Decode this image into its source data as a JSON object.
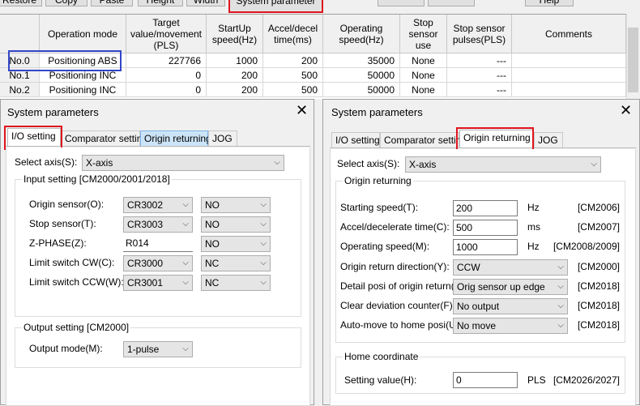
{
  "toolbar": {
    "buttons": [
      "Restore",
      "Copy",
      "Paste",
      "Height",
      "Width",
      "System parameter",
      "",
      "",
      "Help"
    ]
  },
  "grid": {
    "headers": [
      "Operation mode",
      "Target value/movement (PLS)",
      "StartUp speed(Hz)",
      "Accel/decel time(ms)",
      "Operating speed(Hz)",
      "Stop sensor use",
      "Stop sensor pulses(PLS)",
      "Comments"
    ],
    "rows": [
      {
        "no": "No.0",
        "mode": "Positioning ABS",
        "target": "227766",
        "startup": "1000",
        "accel": "200",
        "speed": "35000",
        "stop": "None",
        "pulses": "---"
      },
      {
        "no": "No.1",
        "mode": "Positioning INC",
        "target": "0",
        "startup": "200",
        "accel": "500",
        "speed": "50000",
        "stop": "None",
        "pulses": "---"
      },
      {
        "no": "No.2",
        "mode": "Positioning INC",
        "target": "0",
        "startup": "200",
        "accel": "500",
        "speed": "50000",
        "stop": "None",
        "pulses": "---"
      }
    ]
  },
  "left_dialog": {
    "title": "System parameters",
    "tabs": [
      "I/O setting",
      "Comparator setting",
      "Origin returning",
      "JOG"
    ],
    "select_axis_label": "Select axis(S):",
    "select_axis_value": "X-axis",
    "input_group": "Input setting [CM2000/2001/2018]",
    "inputs": [
      {
        "label": "Origin sensor(O):",
        "value": "CR3002",
        "option": "NO"
      },
      {
        "label": "Stop sensor(T):",
        "value": "CR3003",
        "option": "NO"
      },
      {
        "label": "Z-PHASE(Z):",
        "value": "R014",
        "option": "NO"
      },
      {
        "label": "Limit switch CW(C):",
        "value": "CR3000",
        "option": "NC"
      },
      {
        "label": "Limit switch CCW(W):",
        "value": "CR3001",
        "option": "NC"
      }
    ],
    "output_group": "Output setting [CM2000]",
    "output_label": "Output mode(M):",
    "output_value": "1-pulse"
  },
  "right_dialog": {
    "title": "System parameters",
    "tabs": [
      "I/O setting",
      "Comparator setting",
      "Origin returning",
      "JOG"
    ],
    "select_axis_label": "Select axis(S):",
    "select_axis_value": "X-axis",
    "origin_group": "Origin returning",
    "fields": [
      {
        "label": "Starting speed(T):",
        "value": "200",
        "unit": "Hz",
        "cm": "[CM2006]"
      },
      {
        "label": "Accel/decelerate time(C):",
        "value": "500",
        "unit": "ms",
        "cm": "[CM2007]"
      },
      {
        "label": "Operating speed(M):",
        "value": "1000",
        "unit": "Hz",
        "cm": "[CM2008/2009]"
      }
    ],
    "combos": [
      {
        "label": "Origin return direction(Y):",
        "value": "CCW",
        "cm": "[CM2000]"
      },
      {
        "label": "Detail posi of origin return(O):",
        "value": "Orig sensor up edge",
        "cm": "[CM2018]"
      },
      {
        "label": "Clear deviation counter(F):",
        "value": "No output",
        "cm": "[CM2018]"
      },
      {
        "label": "Auto-move to home posi(U):",
        "value": "No move",
        "cm": "[CM2018]"
      }
    ],
    "home_group": "Home coordinate",
    "home_label": "Setting value(H):",
    "home_value": "0",
    "home_unit": "PLS",
    "home_cm": "[CM2026/2027]"
  },
  "icons": {
    "close": "close-icon",
    "dropdown": "chevron-down-icon"
  },
  "colors": {
    "highlight_red": "#e0141e",
    "highlight_blue": "#3246c8",
    "tab_blue": "#cce4f7"
  }
}
